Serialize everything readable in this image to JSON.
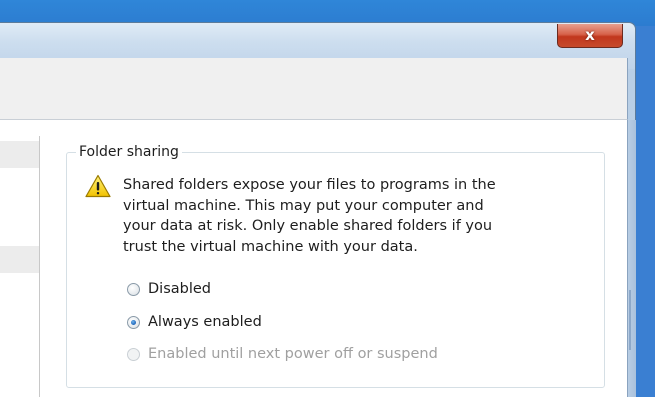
{
  "window": {
    "close_label": "x"
  },
  "folder_sharing": {
    "legend": "Folder sharing",
    "warning_icon": "warning-triangle-icon",
    "warning_lines": [
      "Shared folders expose your files to programs in the",
      "virtual machine. This may put your computer and",
      "your data at risk. Only enable shared folders if you",
      "trust the virtual machine with your data."
    ],
    "options": [
      {
        "label": "Disabled",
        "checked": false,
        "enabled": true
      },
      {
        "label": "Always enabled",
        "checked": true,
        "enabled": true
      },
      {
        "label": "Enabled until next power off or suspend",
        "checked": false,
        "enabled": false
      }
    ]
  }
}
